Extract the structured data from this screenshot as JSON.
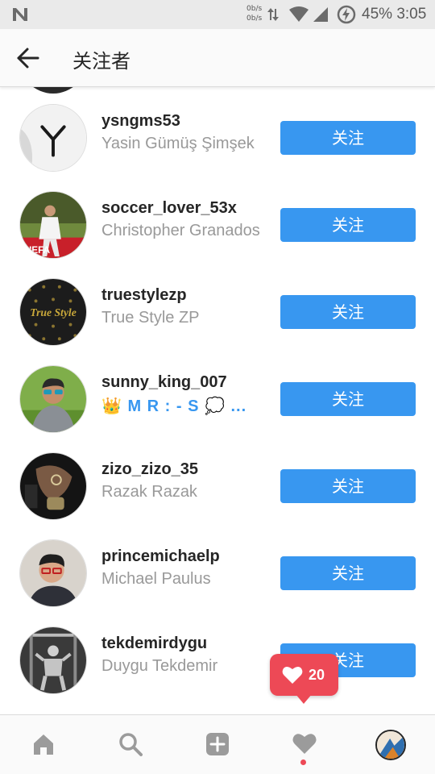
{
  "status_bar": {
    "speed_up": "0b/s",
    "speed_down": "0b/s",
    "battery": "45%",
    "time": "3:05"
  },
  "header": {
    "back_icon": "arrow-left-icon",
    "title": "关注者"
  },
  "followers": [
    {
      "username": "ysngms53",
      "full_name": "Yasin Gümüş Şimşek",
      "button": "关注"
    },
    {
      "username": "soccer_lover_53x",
      "full_name": "Christopher Granados",
      "button": "关注"
    },
    {
      "username": "truestylezp",
      "full_name": "True Style ZP",
      "button": "关注"
    },
    {
      "username": "sunny_king_007",
      "full_name": "👑 M R : - S 💭 ...",
      "button": "关注"
    },
    {
      "username": "zizo_zizo_35",
      "full_name": "Razak Razak",
      "button": "关注"
    },
    {
      "username": "princemichaelp",
      "full_name": "Michael Paulus",
      "button": "关注"
    },
    {
      "username": "tekdemirdygu",
      "full_name": "Duygu Tekdemir",
      "button": "关注"
    }
  ],
  "avatar_texts": {
    "truestyle": "True Style"
  },
  "notification": {
    "icon": "heart-icon",
    "count": "20"
  },
  "bottom_nav": {
    "items": [
      "home-icon",
      "search-icon",
      "add-icon",
      "heart-icon",
      "profile-avatar"
    ],
    "active_dot_color": "#ed4956"
  },
  "colors": {
    "accent": "#3897f0",
    "notification": "#ed4956"
  }
}
